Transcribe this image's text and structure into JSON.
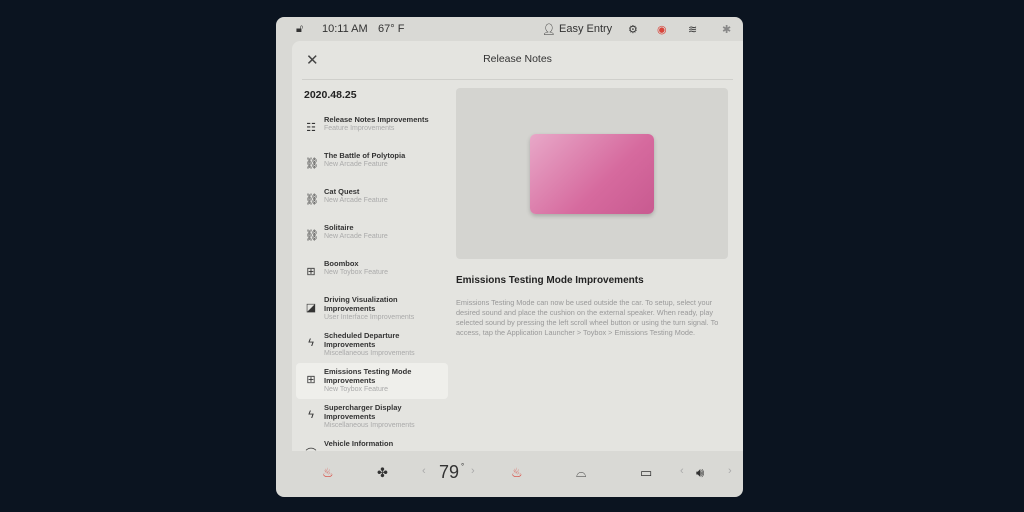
{
  "status": {
    "time": "10:11 AM",
    "temp": "67° F",
    "profile": "Easy Entry"
  },
  "modal": {
    "title": "Release Notes",
    "version": "2020.48.25"
  },
  "items": [
    {
      "title": "Release Notes Improvements",
      "sub": "Feature Improvements",
      "icon": "list-icon"
    },
    {
      "title": "The Battle of Polytopia",
      "sub": "New Arcade Feature",
      "icon": "gamepad-icon"
    },
    {
      "title": "Cat Quest",
      "sub": "New Arcade Feature",
      "icon": "gamepad-icon"
    },
    {
      "title": "Solitaire",
      "sub": "New Arcade Feature",
      "icon": "gamepad-icon"
    },
    {
      "title": "Boombox",
      "sub": "New Toybox Feature",
      "icon": "toybox-icon"
    },
    {
      "title": "Driving Visualization Improvements",
      "sub": "User Interface Improvements",
      "icon": "display-icon"
    },
    {
      "title": "Scheduled Departure Improvements",
      "sub": "Miscellaneous Improvements",
      "icon": "bolt-icon"
    },
    {
      "title": "Emissions Testing Mode Improvements",
      "sub": "New Toybox Feature",
      "icon": "toybox-icon",
      "selected": true
    },
    {
      "title": "Supercharger Display Improvements",
      "sub": "Miscellaneous Improvements",
      "icon": "bolt-icon"
    },
    {
      "title": "Vehicle Information",
      "sub": "",
      "icon": "car-icon"
    }
  ],
  "feature": {
    "title": "Emissions Testing Mode Improvements",
    "body": "Emissions Testing Mode can now be used outside the car. To setup, select your desired sound and place the cushion on the external speaker. When ready, play selected sound by pressing the left scroll wheel button or using the turn signal. To access, tap the Application Launcher > Toybox > Emissions Testing Mode."
  },
  "climate": {
    "temperature": "79",
    "degree": "°"
  },
  "colors": {
    "accent_pink": "#d66a9e",
    "heat_red": "#d9443a"
  }
}
